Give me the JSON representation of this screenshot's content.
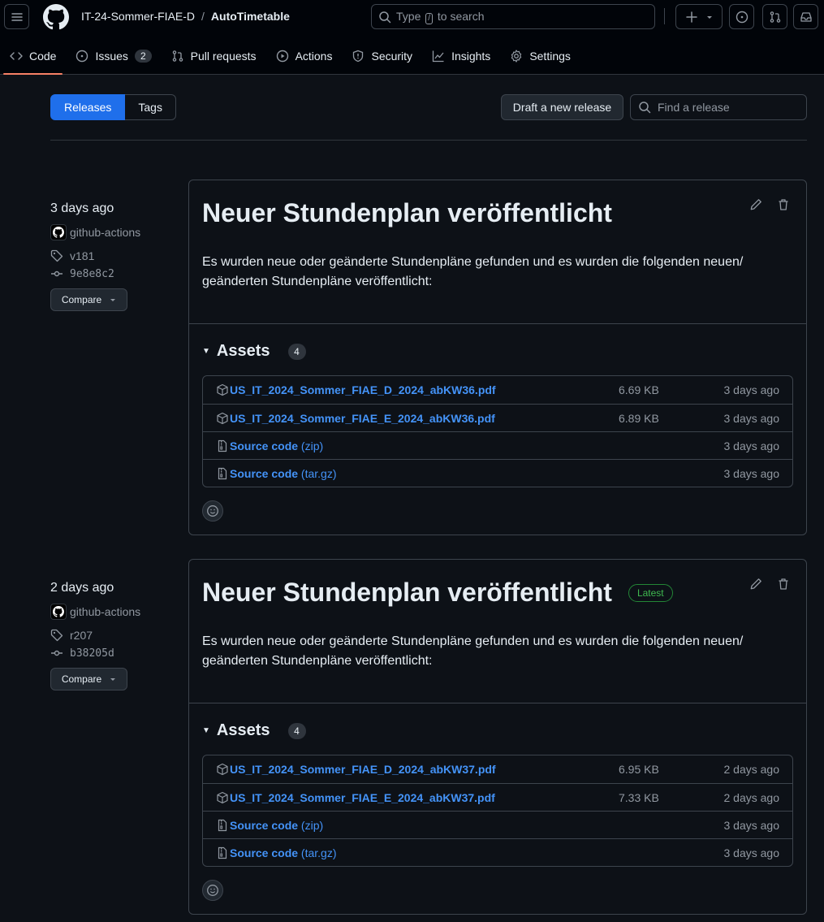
{
  "header": {
    "owner": "IT-24-Sommer-FIAE-D",
    "separator": "/",
    "repo": "AutoTimetable",
    "search": {
      "prefix": "Type",
      "key": "/",
      "suffix": "to search"
    },
    "icons": [
      "hamburger-icon",
      "github-logo-icon",
      "plus-icon",
      "issue-icon",
      "pull-request-icon",
      "inbox-icon"
    ]
  },
  "tabs": [
    {
      "label": "Code",
      "icon": "code-icon",
      "active": true
    },
    {
      "label": "Issues",
      "icon": "issue-icon",
      "count": "2"
    },
    {
      "label": "Pull requests",
      "icon": "pull-request-icon"
    },
    {
      "label": "Actions",
      "icon": "play-icon"
    },
    {
      "label": "Security",
      "icon": "shield-icon"
    },
    {
      "label": "Insights",
      "icon": "graph-icon"
    },
    {
      "label": "Settings",
      "icon": "gear-icon"
    }
  ],
  "subnav": {
    "releases": "Releases",
    "tags": "Tags",
    "draft": "Draft a new release",
    "find_placeholder": "Find a release"
  },
  "releases": [
    {
      "date": "3 days ago",
      "author": "github-actions",
      "tag": "v181",
      "commit": "9e8e8c2",
      "compare": "Compare",
      "title": "Neuer Stundenplan veröffentlicht",
      "latest": null,
      "body": "Es wurden neue oder geänderte Stundenpläne gefunden und es wurden die folgenden neuen/ geänderten Stundenpläne veröffentlicht:",
      "assets_label": "Assets",
      "assets_count": "4",
      "assets": [
        {
          "name": "US_IT_2024_Sommer_FIAE_D_2024_abKW36.pdf",
          "suffix": "",
          "size": "6.69 KB",
          "time": "3 days ago",
          "icon": "package-icon"
        },
        {
          "name": "US_IT_2024_Sommer_FIAE_E_2024_abKW36.pdf",
          "suffix": "",
          "size": "6.89 KB",
          "time": "3 days ago",
          "icon": "package-icon"
        },
        {
          "name": "Source code",
          "suffix": " (zip)",
          "size": "",
          "time": "3 days ago",
          "icon": "file-zip-icon"
        },
        {
          "name": "Source code",
          "suffix": " (tar.gz)",
          "size": "",
          "time": "3 days ago",
          "icon": "file-zip-icon"
        }
      ]
    },
    {
      "date": "2 days ago",
      "author": "github-actions",
      "tag": "r207",
      "commit": "b38205d",
      "compare": "Compare",
      "title": "Neuer Stundenplan veröffentlicht",
      "latest": "Latest",
      "body": "Es wurden neue oder geänderte Stundenpläne gefunden und es wurden die folgenden neuen/ geänderten Stundenpläne veröffentlicht:",
      "assets_label": "Assets",
      "assets_count": "4",
      "assets": [
        {
          "name": "US_IT_2024_Sommer_FIAE_D_2024_abKW37.pdf",
          "suffix": "",
          "size": "6.95 KB",
          "time": "2 days ago",
          "icon": "package-icon"
        },
        {
          "name": "US_IT_2024_Sommer_FIAE_E_2024_abKW37.pdf",
          "suffix": "",
          "size": "7.33 KB",
          "time": "2 days ago",
          "icon": "package-icon"
        },
        {
          "name": "Source code",
          "suffix": " (zip)",
          "size": "",
          "time": "3 days ago",
          "icon": "file-zip-icon"
        },
        {
          "name": "Source code",
          "suffix": " (tar.gz)",
          "size": "",
          "time": "3 days ago",
          "icon": "file-zip-icon"
        }
      ]
    }
  ]
}
